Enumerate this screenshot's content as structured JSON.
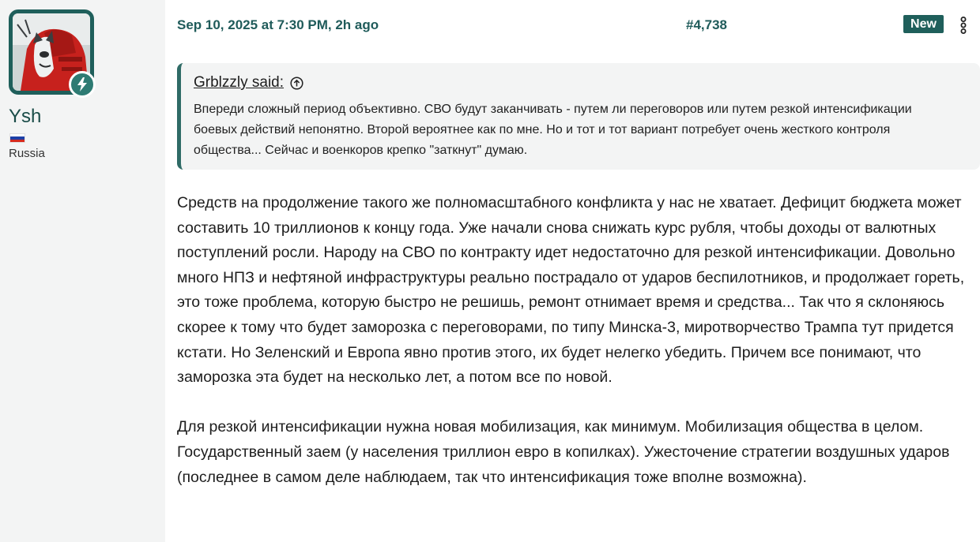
{
  "user": {
    "name": "Ysh",
    "location": "Russia",
    "avatar_icon": "cartoon-cat-avatar",
    "badge_icon": "lightning-bolt-icon",
    "flag_colors": [
      "#ffffff",
      "#1c3fa6",
      "#d52b1e"
    ]
  },
  "post": {
    "date": "Sep 10, 2025 at 7:30 PM, 2h ago",
    "number": "#4,738",
    "new_label": "New",
    "more_icon": "vertical-ellipsis-icon"
  },
  "quote": {
    "author": "Grblzzly said:",
    "jump_icon": "arrow-up-circle-icon",
    "text": "Впереди сложный период объективно. СВО будут заканчивать - путем ли переговоров или путем резкой интенсификации боевых действий непонятно. Второй вероятнее как по мне. Но и тот и тот вариант потребует очень жесткого контроля общества... Сейчас и военкоров крепко \"заткнут\" думаю."
  },
  "body": {
    "paragraph_1": "Средств на продолжение такого же полномасштабного конфликта у нас не хватает. Дефицит бюджета может составить 10 триллионов к концу года. Уже начали снова снижать курс рубля, чтобы доходы от валютных поступлений росли. Народу на СВО по контракту идет недостаточно для резкой интенсификации. Довольно много НПЗ и нефтяной инфраструктуры реально пострадало от ударов беспилотников, и продолжает гореть, это тоже проблема, которую быстро не решишь, ремонт отнимает время и средства... Так что я склоняюсь скорее к тому что будет заморозка с переговорами, по типу Минска-3, миротворчество Трампа тут придется кстати. Но Зеленский и Европа явно против этого, их будет нелегко убедить. Причем все понимают, что заморозка эта будет на несколько лет, а потом все по новой.",
    "paragraph_2": "Для резкой интенсификации нужна новая мобилизация, как минимум. Мобилизация общества в целом. Государственный заем (у населения триллион евро в копилках). Ужесточение стратегии воздушных ударов (последнее в самом деле наблюдаем, так что интенсификация тоже вполне возможна)."
  },
  "colors": {
    "accent": "#1f5f5b",
    "link": "#1f5b5a",
    "panel_bg": "#f3f4f4"
  }
}
